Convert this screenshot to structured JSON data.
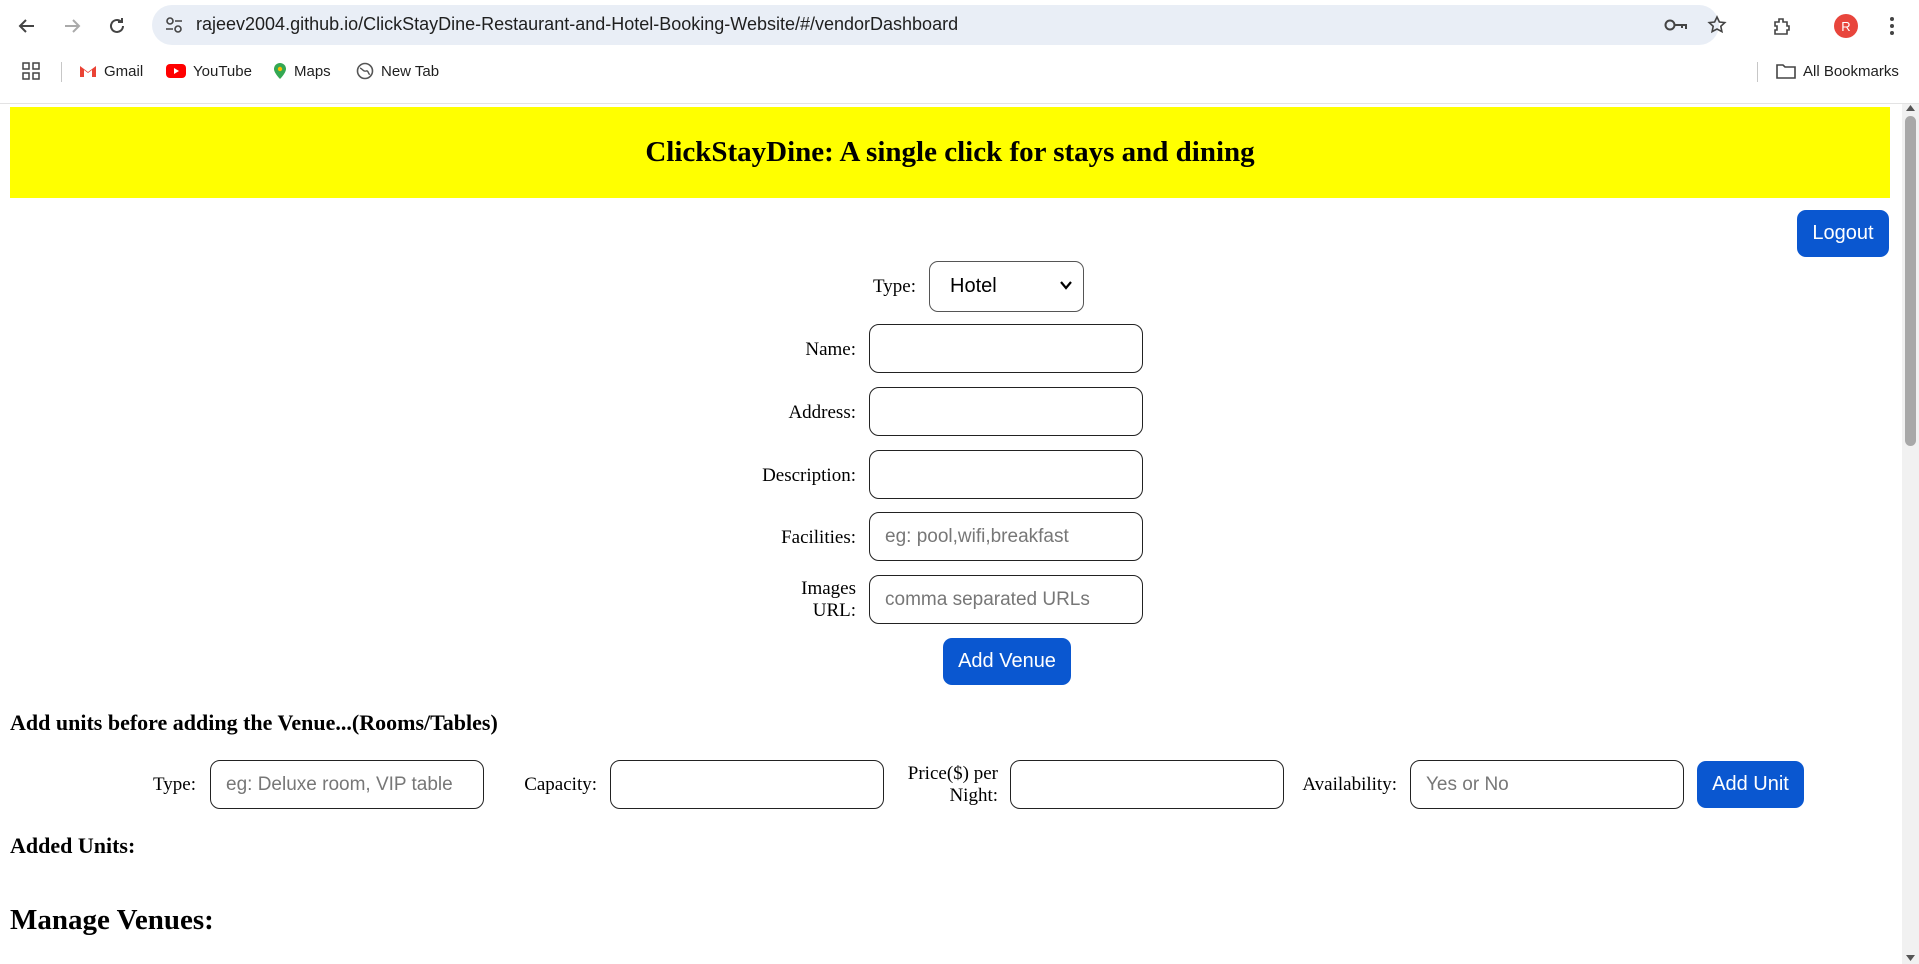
{
  "browser": {
    "url": "rajeev2004.github.io/ClickStayDine-Restaurant-and-Hotel-Booking-Website/#/vendorDashboard",
    "profile_initial": "R",
    "bookmarks": [
      "Gmail",
      "YouTube",
      "Maps",
      "New Tab"
    ],
    "all_bookmarks": "All Bookmarks"
  },
  "header": {
    "title": "ClickStayDine: A single click for stays and dining"
  },
  "logout_label": "Logout",
  "venue_form": {
    "type_label": "Type:",
    "type_value": "Hotel",
    "name_label": "Name:",
    "address_label": "Address:",
    "description_label": "Description:",
    "facilities_label": "Facilities:",
    "facilities_placeholder": "eg: pool,wifi,breakfast",
    "images_label_1": "Images",
    "images_label_2": "URL:",
    "images_placeholder": "comma separated URLs",
    "add_venue_label": "Add Venue"
  },
  "units_section": {
    "heading": "Add units before adding the Venue...(Rooms/Tables)",
    "type_label": "Type:",
    "type_placeholder": "eg: Deluxe room, VIP table",
    "capacity_label": "Capacity:",
    "price_label_1": "Price($) per",
    "price_label_2": "Night:",
    "availability_label": "Availability:",
    "availability_placeholder": "Yes or No",
    "add_unit_label": "Add Unit",
    "added_units_heading": "Added Units:"
  },
  "manage_heading": "Manage Venues:",
  "colors": {
    "banner": "#ffff00",
    "button": "#0a57d0",
    "profile": "#e8453c"
  }
}
